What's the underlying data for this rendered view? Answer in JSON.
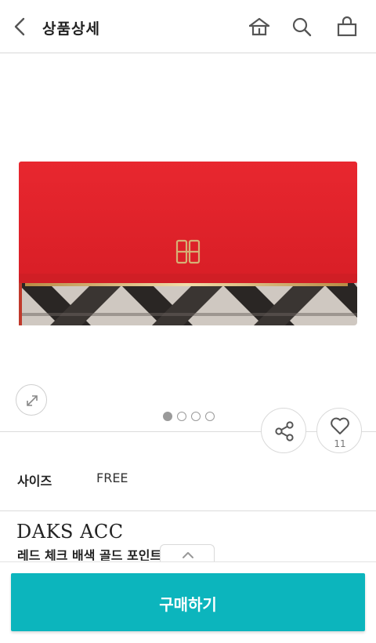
{
  "header": {
    "title": "상품상세",
    "icons": [
      "back-arrow-icon",
      "home-icon",
      "search-icon",
      "shopping-bag-icon"
    ]
  },
  "gallery": {
    "image_count": 4,
    "active_index": 0
  },
  "actions": {
    "like_count": "11"
  },
  "options": {
    "size_label": "사이즈",
    "size_value": "FREE"
  },
  "product": {
    "brand": "DAKS ACC",
    "name": "레드 체크 배색 골드 포인트 장지갑"
  },
  "buy": {
    "label": "구매하기"
  },
  "colors": {
    "accent": "#0cb5bd",
    "wallet_red": "#e0232b",
    "check_dark": "#2a2624",
    "check_light": "#c9c2bb",
    "gold": "#c9a056"
  }
}
